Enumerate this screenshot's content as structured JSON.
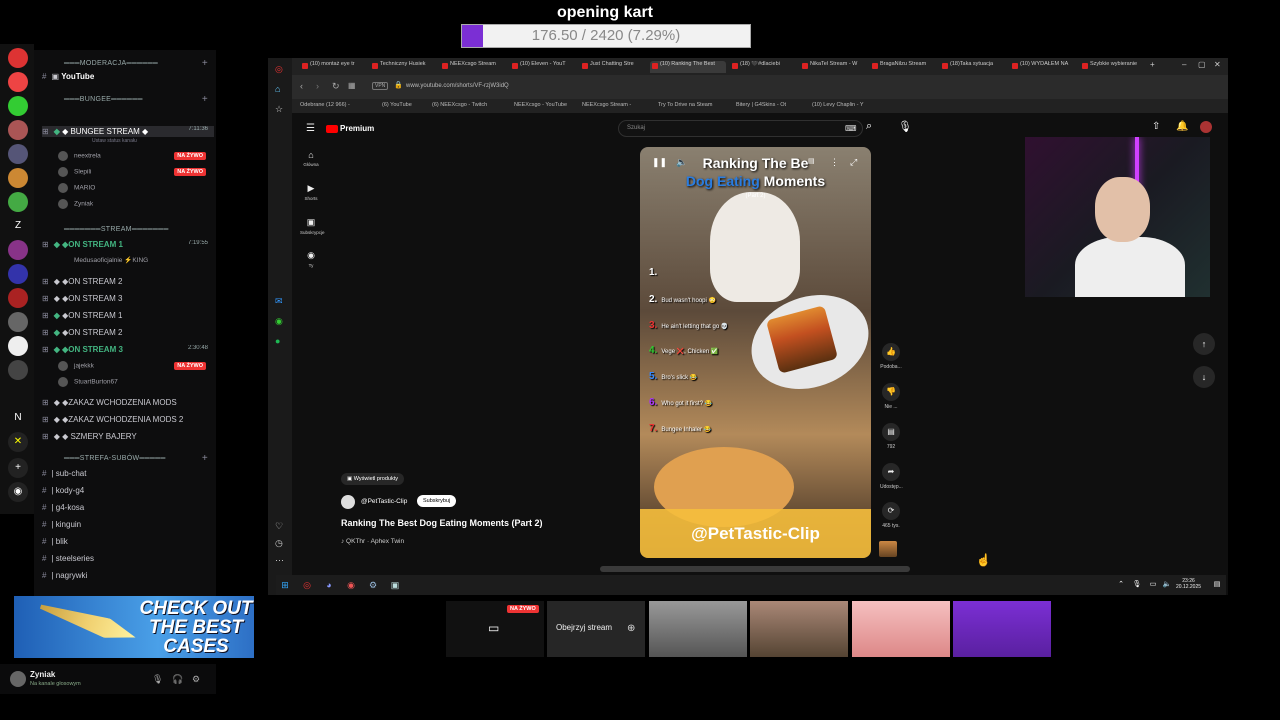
{
  "overlay": {
    "goal_title": "opening kart",
    "goal_text": "176.50 / 2420 (7.29%)",
    "goal_fraction": 0.0729
  },
  "server_rail": {
    "letters": [
      "Z",
      "N"
    ]
  },
  "discord": {
    "categories": [
      {
        "label": "MODERACJA"
      },
      {
        "label": "BUNGEE"
      },
      {
        "label": "STREAM"
      },
      {
        "label": "STREFA-SUBÓW"
      }
    ],
    "youtube_channel": "YouTube",
    "bungee_stream": {
      "label": "◆ BUNGEE STREAM ◆",
      "time": "7:11:36",
      "status": "Ustaw status kanału"
    },
    "bungee_users": [
      {
        "name": "neextrela",
        "live": "NA ŻYWO"
      },
      {
        "name": "Slepili",
        "live": "NA ŻYWO"
      },
      {
        "name": "MARIO",
        "live": ""
      },
      {
        "name": "Zyniak",
        "live": ""
      }
    ],
    "on_stream_1": {
      "label": "◆ON STREAM 1",
      "time": "7:19:55",
      "user": "Medusaoficjalnie ⚡KING"
    },
    "on_streams": [
      "◆ON STREAM 2",
      "◆ON STREAM 3",
      "◆ON STREAM 1",
      "◆ON STREAM 2"
    ],
    "on_stream_3_active": {
      "label": "◆ON STREAM 3",
      "time": "2:30:48",
      "users": [
        {
          "name": "jajekkk",
          "live": "NA ŻYWO"
        },
        {
          "name": "StuartBurton67",
          "live": ""
        }
      ]
    },
    "restricted": [
      "◆ZAKAZ WCHODZENIA MODS",
      "◆ZAKAZ WCHODZENIA MODS 2",
      "◆ SZMERY BAJERY"
    ],
    "sub_channels": [
      "sub-chat",
      "kody-g4",
      "g4-kosa",
      "kinguin",
      "blik",
      "steelseries",
      "nagrywki"
    ],
    "user_panel": {
      "name": "Zyniak",
      "status": "Na kanale głosowym"
    },
    "banner_text": "CHECK OUT THE BEST CASES"
  },
  "browser": {
    "tabs": [
      "(10) montaż eye tr",
      "Techniczny Husiek",
      "NEEXcsgo Stream",
      "(10) Eleven - YouT",
      "Just Chatting Stre",
      "(10) Ranking The Best",
      "(18) 🖤#dlaciebi",
      "NikaTel Stream - W",
      "BragaNilzu Stream",
      "(18)Taka sytuacja",
      "(10) WYDAŁEM NA",
      "Szybkie wybieranie"
    ],
    "url": "www.youtube.com/shorts/VF-rzjW3idQ",
    "bookmarks": [
      "Odebrane (12 966) -",
      "(6) YouTube",
      "(6) NEEXcsgo - Twitch",
      "NEEXcsgo - YouTube",
      "NEEXcsgo Stream -",
      "Try To Drive na Steam",
      "Bitery | G4Skins - Ot",
      "(10) Levy Chaplin - Y"
    ]
  },
  "youtube": {
    "logo": "Premium",
    "search_placeholder": "Szukaj",
    "nav": [
      {
        "icon": "home-icon",
        "label": "Główna"
      },
      {
        "icon": "shorts-icon",
        "label": "Shorts"
      },
      {
        "icon": "subscriptions-icon",
        "label": "Subskrypcje"
      },
      {
        "icon": "you-icon",
        "label": "Ty"
      }
    ],
    "short": {
      "title_line1": "Ranking The Be",
      "title_line2a": "Dog Eating",
      "title_line2b": " Moments",
      "part": "(Part 2)",
      "ranks": [
        {
          "n": "1.",
          "text": ""
        },
        {
          "n": "2.",
          "text": "Bud wasn't hoopi 😳"
        },
        {
          "n": "3.",
          "text": "He ain't letting that go 💀"
        },
        {
          "n": "4.",
          "text": "Vege ❌, Chicken ✅"
        },
        {
          "n": "5.",
          "text": "Bro's slick 😂"
        },
        {
          "n": "6.",
          "text": "Who got it first? 😂"
        },
        {
          "n": "7.",
          "text": "Bungee Inhaler 😂"
        }
      ],
      "handle": "@PetTastic-Clip"
    },
    "actions": [
      {
        "icon": "thumbs-up-icon",
        "label": "Podoba..."
      },
      {
        "icon": "thumbs-down-icon",
        "label": "Nie ..."
      },
      {
        "icon": "comment-icon",
        "label": "792"
      },
      {
        "icon": "share-icon",
        "label": "Udostęp..."
      },
      {
        "icon": "remix-icon",
        "label": "465 tys."
      }
    ],
    "products_label": "Wyświetl produkty",
    "channel_name": "@PetTastic-Clip",
    "subscribe_label": "Subskrybuj",
    "video_title": "Ranking The Best Dog Eating Moments (Part 2)",
    "video_music": "♪ QKThr · Aphex Twin"
  },
  "taskbar": {
    "time": "23:26",
    "date": "20.12.2025"
  },
  "thumbnails": {
    "live_label": "NA ŻYWO",
    "watch_label": "Obejrzyj stream"
  }
}
